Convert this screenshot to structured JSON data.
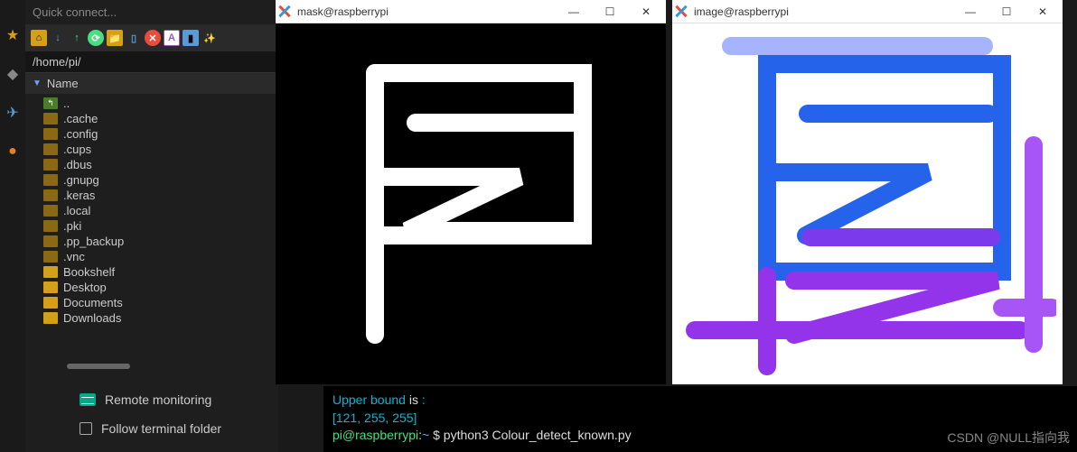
{
  "quick_connect": "Quick connect...",
  "path": "/home/pi/",
  "tree_header": "Name",
  "tree": {
    "up": "..",
    "items": [
      {
        "name": ".cache",
        "dark": true
      },
      {
        "name": ".config",
        "dark": true
      },
      {
        "name": ".cups",
        "dark": true
      },
      {
        "name": ".dbus",
        "dark": true
      },
      {
        "name": ".gnupg",
        "dark": true
      },
      {
        "name": ".keras",
        "dark": true
      },
      {
        "name": ".local",
        "dark": true
      },
      {
        "name": ".pki",
        "dark": true
      },
      {
        "name": ".pp_backup",
        "dark": true
      },
      {
        "name": ".vnc",
        "dark": true
      },
      {
        "name": "Bookshelf",
        "dark": false
      },
      {
        "name": "Desktop",
        "dark": false
      },
      {
        "name": "Documents",
        "dark": false
      },
      {
        "name": "Downloads",
        "dark": false
      }
    ]
  },
  "remote_monitoring": "Remote monitoring",
  "follow_terminal": "Follow terminal folder",
  "windows": {
    "mask": {
      "title": "mask@raspberrypi",
      "min": "—",
      "max": "☐",
      "close": "✕"
    },
    "image": {
      "title": "image@raspberrypi",
      "min": "—",
      "max": "☐",
      "close": "✕"
    }
  },
  "terminal": {
    "line1_a": "Upper bound ",
    "line1_b": "is",
    "line1_c": " :",
    "line2": "[121, 255, 255]",
    "prompt_user": "pi@raspberrypi",
    "prompt_sep": ":",
    "prompt_path": "~",
    "prompt_dollar": " $ ",
    "cmd": "python3 Colour_detect_known.py"
  },
  "watermark": "CSDN @NULL指向我"
}
